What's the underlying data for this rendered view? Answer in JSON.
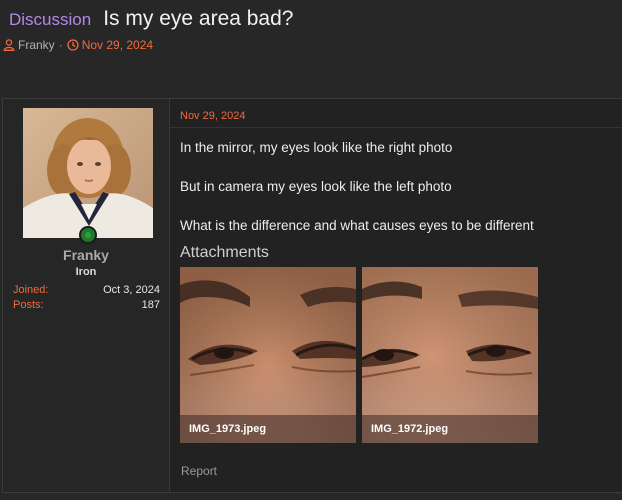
{
  "thread": {
    "prefix": "Discussion",
    "title": "Is my eye area bad?",
    "author": "Franky",
    "separator": "·",
    "date": "Nov 29, 2024"
  },
  "user": {
    "name": "Franky",
    "title": "Iron",
    "stats": [
      {
        "label": "Joined:",
        "value": "Oct 3, 2024"
      },
      {
        "label": "Posts:",
        "value": "187"
      }
    ]
  },
  "post": {
    "date": "Nov 29, 2024",
    "lines": [
      "In the mirror, my eyes look like the right photo",
      "But in camera my eyes look like the left photo",
      "What is the difference and what causes eyes to be different"
    ],
    "attachments_heading": "Attachments",
    "attachments": [
      {
        "filename": "IMG_1973.jpeg"
      },
      {
        "filename": "IMG_1972.jpeg"
      }
    ],
    "report_label": "Report"
  },
  "colors": {
    "accent_orange": "#f26a3c",
    "prefix_purple": "#b487ea",
    "background": "#272727"
  },
  "icons": {
    "author": "user-icon",
    "date": "clock-icon"
  }
}
